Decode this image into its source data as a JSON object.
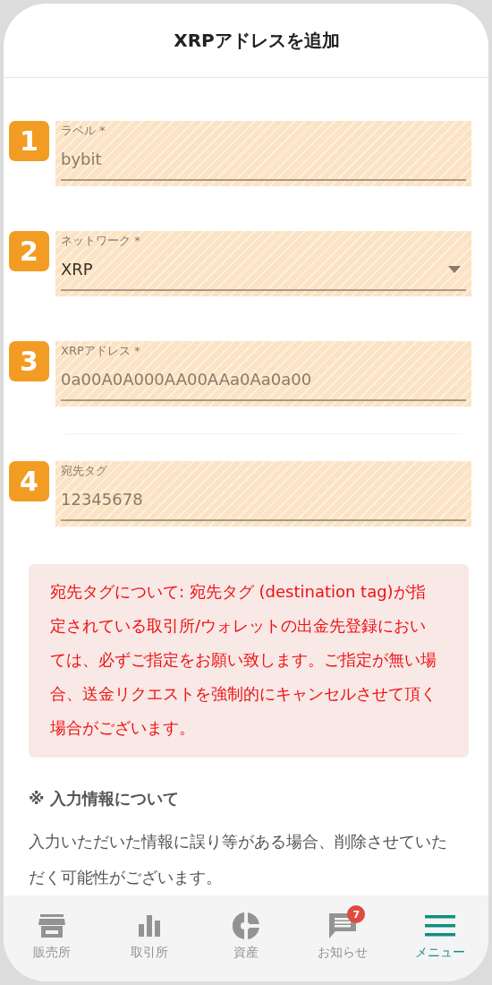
{
  "header": {
    "title": "XRPアドレスを追加"
  },
  "fields": [
    {
      "number": "1",
      "kind": "text",
      "label": "ラベル *",
      "value": "bybit"
    },
    {
      "number": "2",
      "kind": "select",
      "label": "ネットワーク *",
      "value": "XRP"
    },
    {
      "number": "3",
      "kind": "text",
      "label": "XRPアドレス *",
      "value": "0a00A0A000AA00AAa0Aa0a00"
    },
    {
      "number": "4",
      "kind": "text",
      "label": "宛先タグ",
      "value": "12345678"
    }
  ],
  "notice": {
    "text": "宛先タグについて: 宛先タグ (destination tag)が指定されている取引所/ウォレットの出金先登録においては、必ずご指定をお願い致します。ご指定が無い場合、送金リクエストを強制的にキャンセルさせて頂く場合がございます。"
  },
  "info": {
    "heading": "※ 入力情報について",
    "text": "入力いただいた情報に誤り等がある場合、削除させていただく可能性がございます。"
  },
  "nav": [
    {
      "kind": "shop",
      "label": "販売所",
      "selected": false
    },
    {
      "kind": "chart",
      "label": "取引所",
      "selected": false
    },
    {
      "kind": "pie",
      "label": "資産",
      "selected": false
    },
    {
      "kind": "message",
      "label": "お知らせ",
      "selected": false,
      "badge": "7"
    },
    {
      "kind": "menu",
      "label": "メニュー",
      "selected": true
    }
  ]
}
